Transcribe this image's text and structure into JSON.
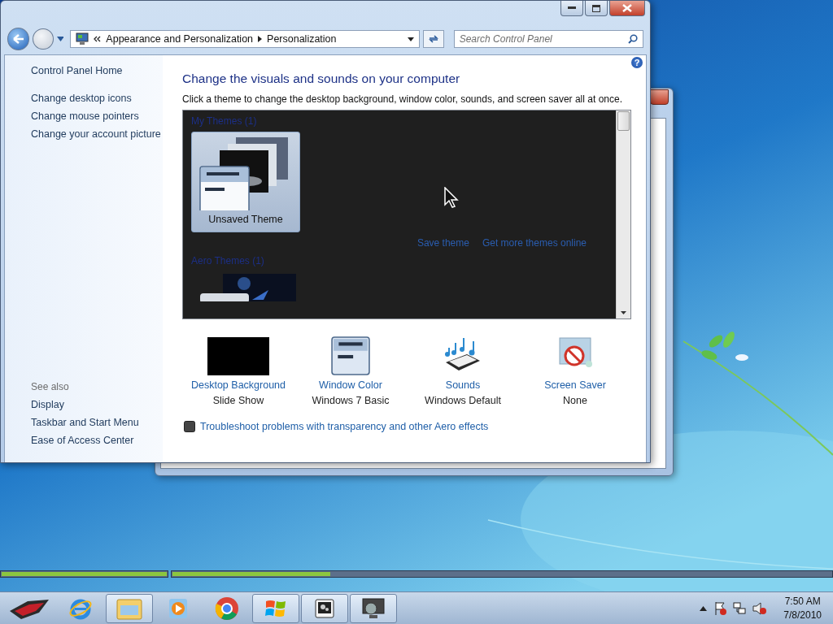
{
  "window": {
    "breadcrumb": [
      {
        "label": "Appearance and Personalization"
      },
      {
        "label": "Personalization"
      }
    ],
    "search": {
      "placeholder": "Search Control Panel"
    },
    "help": "?"
  },
  "sidebar": {
    "home": "Control Panel Home",
    "items": [
      {
        "label": "Change desktop icons"
      },
      {
        "label": "Change mouse pointers"
      },
      {
        "label": "Change your account picture"
      }
    ],
    "see_also_heading": "See also",
    "see_also": [
      {
        "label": "Display"
      },
      {
        "label": "Taskbar and Start Menu"
      },
      {
        "label": "Ease of Access Center"
      }
    ]
  },
  "content": {
    "heading": "Change the visuals and sounds on your computer",
    "description": "Click a theme to change the desktop background, window color, sounds, and screen saver all at once.",
    "theme_groups": [
      {
        "title": "My Themes (1)",
        "items": [
          {
            "label": "Unsaved Theme",
            "selected": true
          }
        ],
        "links": [
          {
            "label": "Save theme"
          },
          {
            "label": "Get more themes online"
          }
        ]
      },
      {
        "title": "Aero Themes (1)",
        "items": [
          {
            "selected": false
          }
        ]
      }
    ],
    "settings": [
      {
        "kind": "background",
        "title": "Desktop Background",
        "value": "Slide Show"
      },
      {
        "kind": "color",
        "title": "Window Color",
        "value": "Windows 7 Basic"
      },
      {
        "kind": "sounds",
        "title": "Sounds",
        "value": "Windows Default"
      },
      {
        "kind": "screensaver",
        "title": "Screen Saver",
        "value": "None"
      }
    ],
    "troubleshoot_link": "Troubleshoot problems with transparency and other Aero effects"
  },
  "progress_bars": [
    {
      "level": 1
    },
    {
      "level": 0.24
    }
  ],
  "taskbar": {
    "items": [
      {
        "kind": "start",
        "running": false
      },
      {
        "kind": "browser",
        "running": false
      },
      {
        "kind": "folder",
        "running": true
      },
      {
        "kind": "media",
        "running": false
      },
      {
        "kind": "chrome",
        "running": false
      },
      {
        "kind": "windows",
        "running": true
      },
      {
        "kind": "gears",
        "running": true
      },
      {
        "kind": "monitor",
        "running": true
      }
    ],
    "time": "7:50 AM",
    "date": "7/8/2010"
  }
}
